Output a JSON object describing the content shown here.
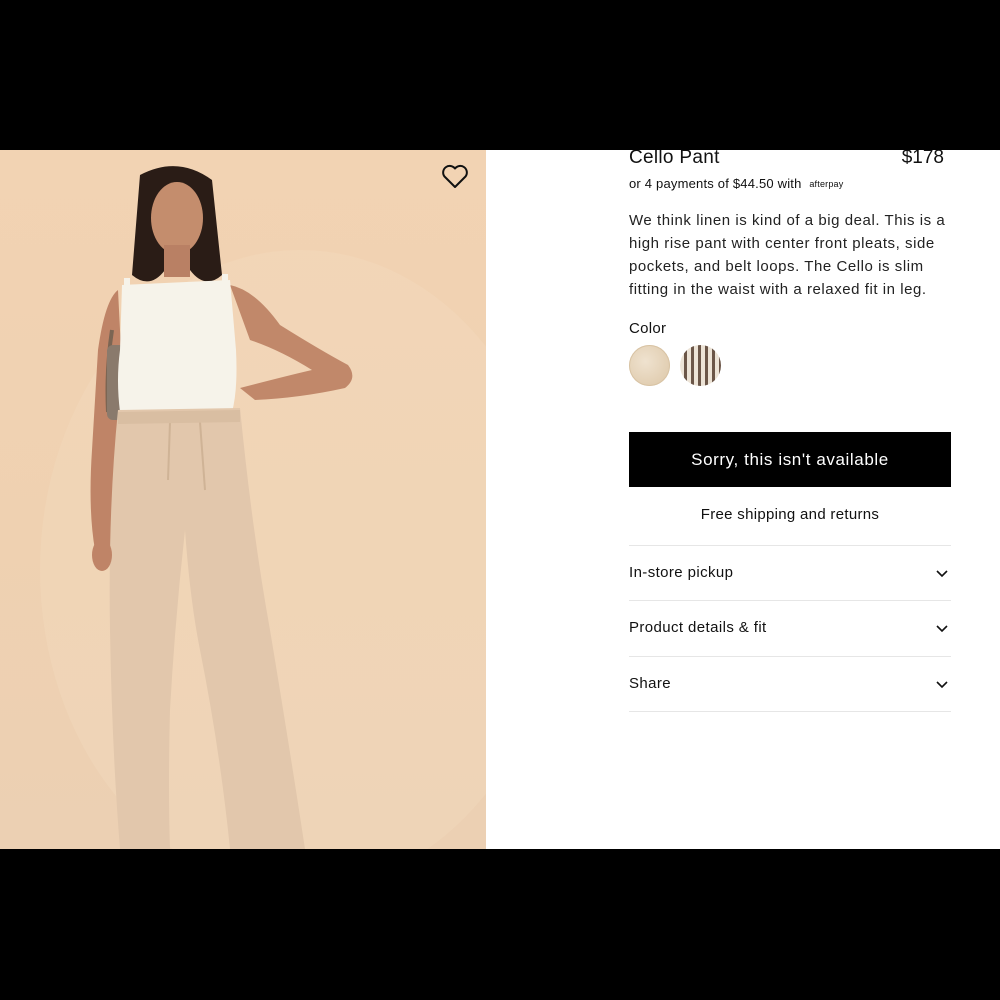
{
  "product": {
    "name": "Cello Pant",
    "price": "$178",
    "installments_text": "or 4 payments of $44.50 with",
    "installments_logo": "afterpay",
    "description": "We think linen is kind of a big deal. This is a high rise pant with center front pleats, side pockets, and belt loops. The Cello is slim fitting in the waist with a relaxed fit in leg."
  },
  "color": {
    "label": "Color",
    "swatches": [
      {
        "name": "natural-linen",
        "color": "#e3cfb3"
      },
      {
        "name": "brown-stripe",
        "color": "#6b5648"
      }
    ]
  },
  "cta": {
    "label": "Sorry, this isn't available"
  },
  "shipping": {
    "label": "Free shipping and returns"
  },
  "accordions": [
    {
      "label": "In-store pickup"
    },
    {
      "label": "Product details & fit"
    },
    {
      "label": "Share"
    }
  ],
  "icons": {
    "favorite": "heart-icon",
    "expand": "chevron-down-icon"
  },
  "colors": {
    "photo_background": "#f1d3b3",
    "button_background": "#000000",
    "divider": "#e6e6e6"
  }
}
